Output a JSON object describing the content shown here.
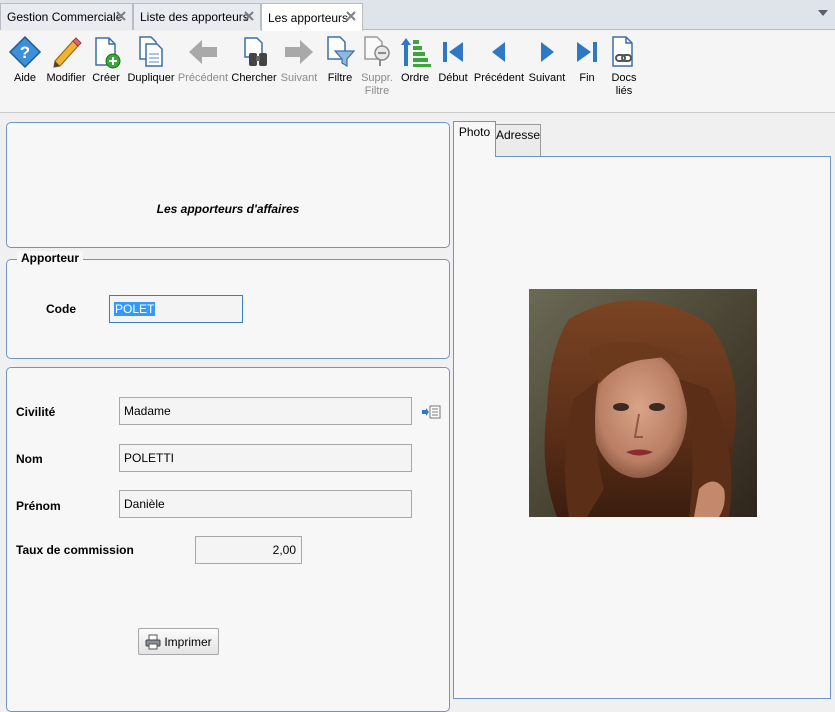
{
  "tabs": [
    {
      "label": "Gestion Commerciale"
    },
    {
      "label": "Liste des apporteurs"
    },
    {
      "label": "Les apporteurs"
    }
  ],
  "toolbar": {
    "aide": "Aide",
    "modifier": "Modifier",
    "creer": "Créer",
    "dupliquer": "Dupliquer",
    "precedent_disabled": "Précédent",
    "chercher": "Chercher",
    "suivant_disabled": "Suivant",
    "filtre": "Filtre",
    "suppr_filtre_1": "Suppr.",
    "suppr_filtre_2": "Filtre",
    "ordre": "Ordre",
    "debut": "Début",
    "precedent": "Précédent",
    "suivant": "Suivant",
    "fin": "Fin",
    "docs_1": "Docs",
    "docs_2": "liés"
  },
  "header": {
    "title": "Les apporteurs d'affaires"
  },
  "apporteur": {
    "legend": "Apporteur",
    "code_label": "Code",
    "code_value": "POLET"
  },
  "details": {
    "civilite_label": "Civilité",
    "civilite_value": "Madame",
    "nom_label": "Nom",
    "nom_value": "POLETTI",
    "prenom_label": "Prénom",
    "prenom_value": "Danièle",
    "taux_label": "Taux de commission",
    "taux_value": "2,00",
    "print_label": "Imprimer"
  },
  "right_tabs": {
    "photo": "Photo",
    "adresse": "Adresse"
  },
  "icons": {
    "aide": "help-icon",
    "modifier": "pencil-icon",
    "creer": "new-document-icon",
    "dupliquer": "duplicate-icon",
    "precedent": "left-arrow-icon",
    "chercher": "binoculars-icon",
    "suivant": "right-arrow-icon",
    "filtre": "filter-icon",
    "suppr_filtre": "remove-filter-icon",
    "ordre": "sort-icon",
    "debut": "first-record-icon",
    "fin": "last-record-icon",
    "docs": "linked-docs-icon"
  },
  "colors": {
    "accent": "#1f6fc4",
    "panel_border": "#6e95c8",
    "selection": "#3399ff"
  }
}
